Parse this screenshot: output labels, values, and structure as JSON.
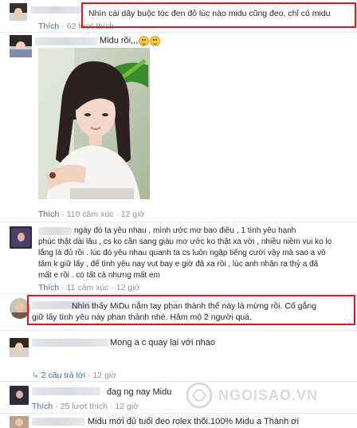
{
  "comments": [
    {
      "id": "c1",
      "text_lines": [
        "Nhìn cái dây buộc tóc đen đỏ lúc nào midu cũng đeo, chỉ có midu"
      ],
      "meta": {
        "like": "Thích",
        "reactions": "62 lượt thích"
      }
    },
    {
      "id": "c2",
      "text_lines": [
        "Midu rồi,,,"
      ],
      "meta": {
        "like": "Thích",
        "reactions": "110 cảm xúc",
        "time": "12 giờ"
      }
    },
    {
      "id": "c3",
      "text_lines": [
        "ngày đó ta yêu nhau , mình ước mơ bao điều , 1 tình yêu hạnh",
        "phúc thật dài lâu , cs ko cần sang giàu mơ ước ko thật xa vời , nhiều niềm vui ko lo",
        "lắng là đủ rồi . lúc đó yêu nhau quanh ta cs luôn ngập tiếng cười vậy mà sao a vô",
        "tâm k giữ lấy , để tình yêu nay vụt bay e giờ đã xa rồi , lúc anh nhận ra thỳ a đã",
        "mất e rồi . có tất cả nhưng mất em"
      ],
      "meta": {
        "like": "Thích",
        "reactions": "11 cảm xúc",
        "time": "12 giờ"
      }
    },
    {
      "id": "c4",
      "text_lines": [
        "Nhìn thấy MiDu nắm tay phan thành thế này là mừng rồi. Cố gắng",
        "giữ lấy tình yêu này phan thành nhé. Hâm mộ 2 người quá."
      ],
      "meta": {}
    },
    {
      "id": "c5",
      "text_lines": [
        "Mong a c quay lại với nhao"
      ],
      "meta": {
        "replies": "2 câu trả lời",
        "time": "12 giờ"
      }
    },
    {
      "id": "c6",
      "text_lines": [
        "đag ng nay Midu"
      ],
      "meta": {
        "like": "Thích",
        "reactions": "25 lượt thích",
        "time": "12 giờ"
      }
    },
    {
      "id": "c7",
      "text_lines": [
        "Midu mới đủ tuổi đeo rolex thôi.100% Midu a Thành ơi"
      ],
      "meta": {}
    }
  ],
  "separator": "·",
  "watermark": "NGOISAO.VN",
  "colors": {
    "highlight_border": "#d7191c",
    "link": "#4267b2",
    "meta_text": "#90949c"
  }
}
